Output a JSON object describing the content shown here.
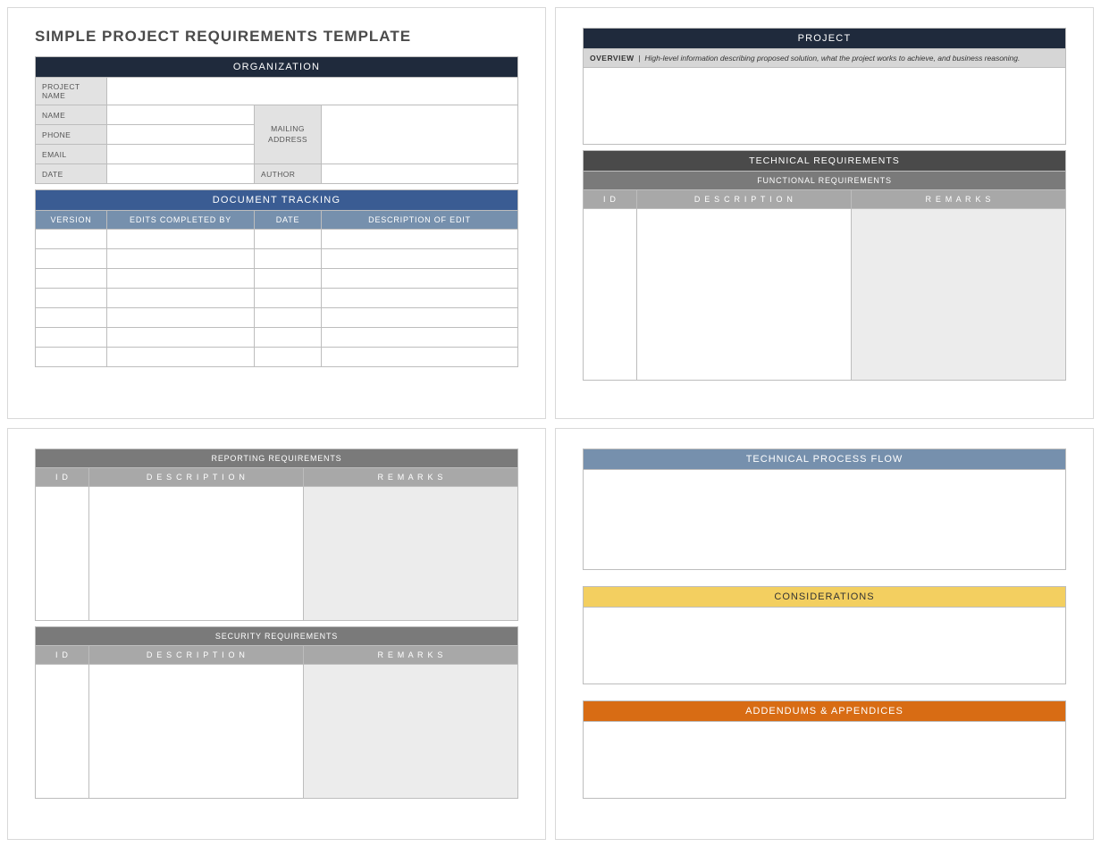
{
  "page1": {
    "title": "SIMPLE PROJECT REQUIREMENTS TEMPLATE",
    "org_header": "ORGANIZATION",
    "fields": {
      "project_name": "PROJECT NAME",
      "name": "NAME",
      "phone": "PHONE",
      "email": "EMAIL",
      "date": "DATE",
      "mailing_address": "MAILING ADDRESS",
      "author": "AUTHOR"
    },
    "tracking_header": "DOCUMENT TRACKING",
    "tracking_cols": {
      "version": "VERSION",
      "edits_by": "EDITS COMPLETED BY",
      "date": "DATE",
      "desc": "DESCRIPTION OF EDIT"
    }
  },
  "page2": {
    "project_header": "PROJECT",
    "overview_label": "OVERVIEW",
    "overview_hint": "High-level information describing proposed solution, what the project works to achieve, and business reasoning.",
    "tech_req_header": "TECHNICAL REQUIREMENTS",
    "func_req_header": "FUNCTIONAL REQUIREMENTS",
    "cols": {
      "id": "I D",
      "desc": "D E S C R I P T I O N",
      "remarks": "R E M A R K S"
    }
  },
  "page3": {
    "reporting_header": "REPORTING REQUIREMENTS",
    "security_header": "SECURITY REQUIREMENTS",
    "cols": {
      "id": "I D",
      "desc": "D E S C R I P T I O N",
      "remarks": "R E M A R K S"
    }
  },
  "page4": {
    "tech_flow_header": "TECHNICAL PROCESS FLOW",
    "considerations_header": "CONSIDERATIONS",
    "addendums_header": "ADDENDUMS & APPENDICES"
  }
}
